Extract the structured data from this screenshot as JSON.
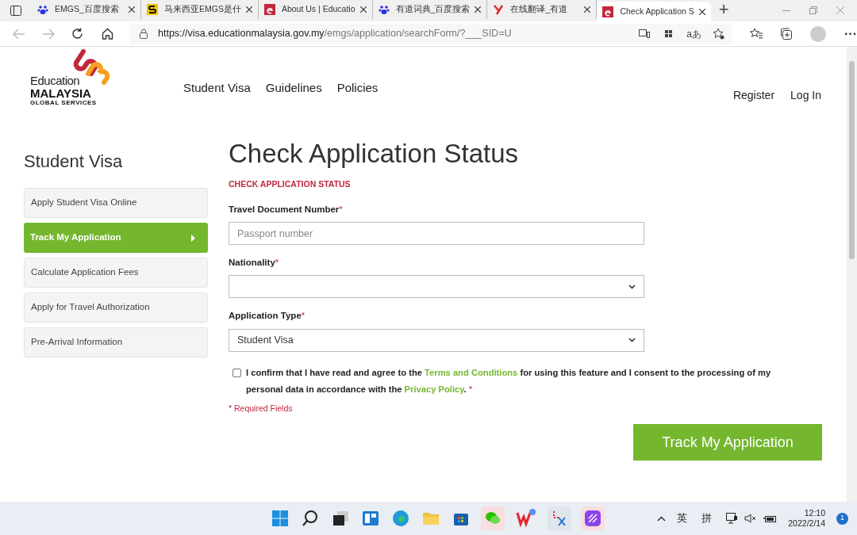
{
  "browser": {
    "tabs": [
      {
        "title": "EMGS_百度搜索",
        "kind": "paw",
        "selected": false
      },
      {
        "title": "马来西亚EMGS是什",
        "kind": "s",
        "selected": false
      },
      {
        "title": "About Us | Educatio",
        "kind": "e",
        "selected": false
      },
      {
        "title": "有道词典_百度搜索",
        "kind": "paw",
        "selected": false
      },
      {
        "title": "在线翻译_有道",
        "kind": "y",
        "selected": false
      },
      {
        "title": "Check Application S",
        "kind": "e",
        "selected": true
      }
    ],
    "new_tab": "+",
    "translate_button": "aあ",
    "more_button": "···",
    "url_host": "https://visa.educationmalaysia.gov.my",
    "url_path": "/emgs/application/searchForm/?___SID=U"
  },
  "header": {
    "logo": {
      "line1": "Education",
      "line2": "MALAYSIA",
      "line3": "GLOBAL SERVICES"
    },
    "nav": [
      "Student Visa",
      "Guidelines",
      "Policies"
    ],
    "account": [
      "Register",
      "Log In"
    ]
  },
  "sidebar": {
    "title": "Student Visa",
    "items": [
      {
        "label": "Apply Student Visa Online",
        "selected": false
      },
      {
        "label": "Track My Application",
        "selected": true
      },
      {
        "label": "Calculate Application Fees",
        "selected": false
      },
      {
        "label": "Apply for Travel Authorization",
        "selected": false
      },
      {
        "label": "Pre-Arrival Information",
        "selected": false
      }
    ]
  },
  "main": {
    "title": "Check Application Status",
    "section": "CHECK APPLICATION STATUS",
    "fields": [
      {
        "kind": "text",
        "label": "Travel Document Number",
        "required_mark": "*",
        "placeholder": "Passport number"
      },
      {
        "kind": "select",
        "label": "Nationality",
        "required_mark": "*"
      },
      {
        "kind": "select",
        "label": "Application Type",
        "required_mark": "*",
        "value": "Student Visa"
      }
    ],
    "consent": {
      "checked": false,
      "segments": [
        {
          "kind": "text",
          "text": "I confirm that I have read and agree to the "
        },
        {
          "kind": "link",
          "text": "Terms and Conditions"
        },
        {
          "kind": "text",
          "text": " for using this feature and I consent to the processing of my personal data in accordance with the "
        },
        {
          "kind": "link",
          "text": "Privacy Policy"
        },
        {
          "kind": "text",
          "text": ". "
        },
        {
          "kind": "required",
          "text": "*"
        }
      ]
    },
    "required_note": "* Required Fields",
    "submit": "Track My Application"
  },
  "taskbar": {
    "tray": [
      "英",
      "拼"
    ],
    "time": "12:10",
    "date": "2022/2/14",
    "notifications": "1"
  }
}
